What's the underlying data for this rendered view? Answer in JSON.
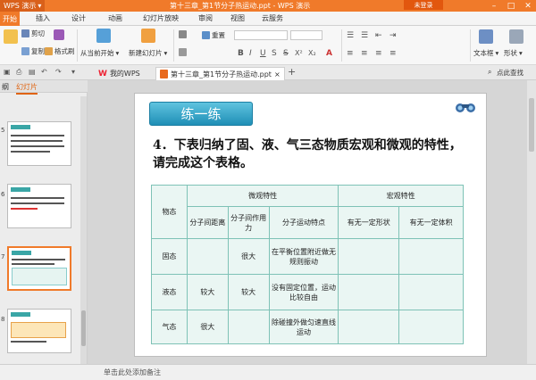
{
  "titlebar": {
    "app_name": "WPS 演示",
    "title": "第十三章_第1节分子热运动.ppt - WPS 演示",
    "login": "未登录"
  },
  "menu": {
    "tabs": [
      "开始",
      "插入",
      "设计",
      "动画",
      "幻灯片放映",
      "审阅",
      "视图",
      "云服务"
    ]
  },
  "ribbon": {
    "cut": "剪切",
    "copy": "复制",
    "format_painter": "格式刷",
    "from_current": "从当前开始",
    "new_slide": "新建幻灯片",
    "reset": "重置",
    "textbox": "文本框",
    "shape": "形状"
  },
  "docbar": {
    "tab1": "我的WPS",
    "tab2": "第十三章_第1节分子热运动.ppt",
    "right_label": "点此查找"
  },
  "left_panel": {
    "tab_outline": "纲",
    "tab_slides": "幻灯片",
    "slide_numbers": [
      "5",
      "6",
      "7",
      "8"
    ]
  },
  "slide": {
    "practice_title": "练一练",
    "question": "4．下表归纳了固、液、气三态物质宏观和微观的特性，请完成这个表格。",
    "table": {
      "h_state": "物态",
      "h_micro": "微观特性",
      "h_macro": "宏观特性",
      "h_dist": "分子间距离",
      "h_force": "分子间作用力",
      "h_motion": "分子运动特点",
      "h_shape": "有无一定形状",
      "h_volume": "有无一定体积",
      "rows": [
        {
          "state": "固态",
          "dist": "",
          "force": "很大",
          "motion": "在平衡位置附近做无规则振动",
          "shape": "",
          "volume": ""
        },
        {
          "state": "液态",
          "dist": "较大",
          "force": "较大",
          "motion": "没有固定位置，运动比较自由",
          "shape": "",
          "volume": ""
        },
        {
          "state": "气态",
          "dist": "很大",
          "force": "",
          "motion": "除碰撞外做匀速直线运动",
          "shape": "",
          "volume": ""
        }
      ]
    }
  },
  "statusbar": {
    "notes": "单击此处添加备注"
  }
}
